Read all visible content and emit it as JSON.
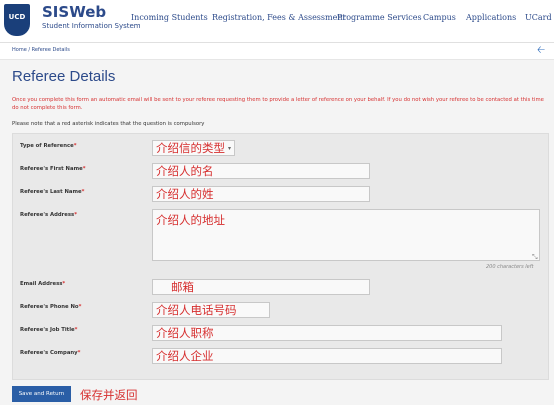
{
  "header": {
    "logo_text": "UCD",
    "brand_title": "SISWeb",
    "brand_subtitle": "Student Information System",
    "nav": [
      "Incoming Students",
      "Registration, Fees & Assessment",
      "Programme Services",
      "Campus",
      "Applications",
      "UCard"
    ]
  },
  "breadcrumb": "Home  /  Referee Details",
  "page_title": "Referee Details",
  "info_text": "Once you complete this form an automatic email will be sent to your referee requesting them to provide a letter of reference on your behalf. If you do not wish your referee to be contacted at this time do not complete this form.",
  "note_text": "Please note that a red asterisk indicates that the question is compulsory",
  "fields": {
    "type_of_reference": {
      "label": "Type of Reference",
      "value": "介绍信的类型"
    },
    "first_name": {
      "label": "Referee's First Name",
      "value": "介绍人的名"
    },
    "last_name": {
      "label": "Referee's Last Name",
      "value": "介绍人的姓"
    },
    "address": {
      "label": "Referee's Address",
      "value": "介绍人的地址"
    },
    "email": {
      "label": "Email Address",
      "value": "邮箱"
    },
    "phone": {
      "label": "Referee's Phone No",
      "value": "介绍人电话号码"
    },
    "job_title": {
      "label": "Referee's Job Title",
      "value": "介绍人职称"
    },
    "company": {
      "label": "Referee's Company",
      "value": "介绍人企业"
    }
  },
  "required_mark": "*",
  "address_char_limit": "200 characters left",
  "save_button": "Save and Return",
  "save_annotation": "保存并返回",
  "colors": {
    "brand": "#2c4a8a",
    "annotation": "#d62f2f",
    "button": "#2a5ea6"
  },
  "icons": {
    "crest": "ucd-crest-icon",
    "back": "back-arrow-icon",
    "select_caret": "chevron-down-icon",
    "resize": "resize-handle-icon"
  }
}
